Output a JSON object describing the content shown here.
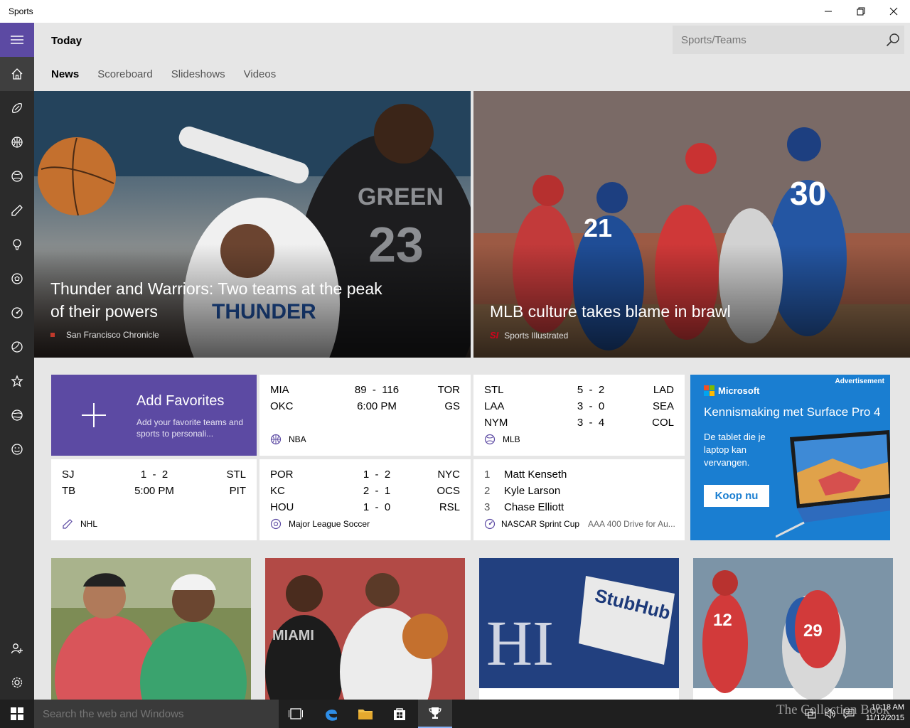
{
  "window": {
    "title": "Sports",
    "controls": [
      "minimize-icon",
      "restore-icon",
      "close-icon"
    ]
  },
  "nav": {
    "items": [
      "home-icon",
      "football-icon",
      "basketball-icon",
      "baseball-icon",
      "hockey-icon",
      "golf-icon",
      "soccer-icon",
      "racing-icon",
      "tennis-icon",
      "star-icon",
      "world-ball-icon",
      "smiley-icon"
    ],
    "bottom": [
      "user-add-icon",
      "gear-icon"
    ]
  },
  "header": {
    "title": "Today",
    "search_placeholder": "Sports/Teams",
    "tabs": [
      {
        "label": "News",
        "active": true
      },
      {
        "label": "Scoreboard",
        "active": false
      },
      {
        "label": "Slideshows",
        "active": false
      },
      {
        "label": "Videos",
        "active": false
      }
    ]
  },
  "hero": [
    {
      "title": "Thunder and Warriors: Two teams at the peak of their powers",
      "source": "San Francisco Chronicle",
      "source_logo": ""
    },
    {
      "title": "MLB culture takes blame in brawl",
      "source": "Sports Illustrated",
      "source_logo": "SI"
    }
  ],
  "favorites": {
    "title": "Add Favorites",
    "description": "Add your favorite teams and sports to personali..."
  },
  "scores": {
    "nba": {
      "league": "NBA",
      "games": [
        {
          "home": "MIA",
          "score": "89  -  116",
          "away": "TOR"
        },
        {
          "home": "OKC",
          "score": "6:00 PM",
          "away": "GS"
        }
      ]
    },
    "mlb": {
      "league": "MLB",
      "games": [
        {
          "home": "STL",
          "score": "5  -  2",
          "away": "LAD"
        },
        {
          "home": "LAA",
          "score": "3  -  0",
          "away": "SEA"
        },
        {
          "home": "NYM",
          "score": "3  -  4",
          "away": "COL"
        }
      ]
    },
    "nhl": {
      "league": "NHL",
      "games": [
        {
          "home": "SJ",
          "score": "1  -  2",
          "away": "STL"
        },
        {
          "home": "TB",
          "score": "5:00 PM",
          "away": "PIT"
        }
      ]
    },
    "mls": {
      "league": "Major League Soccer",
      "games": [
        {
          "home": "POR",
          "score": "1  -  2",
          "away": "NYC"
        },
        {
          "home": "KC",
          "score": "2  -  1",
          "away": "OCS"
        },
        {
          "home": "HOU",
          "score": "1  -  0",
          "away": "RSL"
        }
      ]
    },
    "nascar": {
      "league": "NASCAR Sprint Cup",
      "event": "AAA 400 Drive for Au...",
      "standings": [
        {
          "pos": "1",
          "driver": "Matt Kenseth"
        },
        {
          "pos": "2",
          "driver": "Kyle Larson"
        },
        {
          "pos": "3",
          "driver": "Chase Elliott"
        }
      ]
    }
  },
  "ad": {
    "tag": "Advertisement",
    "brand": "Microsoft",
    "title": "Kennismaking met Surface Pro 4",
    "body": "De tablet die je laptop kan vervangen.",
    "cta": "Koop nu"
  },
  "taskbar": {
    "search_placeholder": "Search the web and Windows",
    "time": "10:18 AM",
    "date": "11/12/2015",
    "watermark": "The Collection Book"
  },
  "colors": {
    "accent": "#5c4aa3",
    "rail": "#2b2b2b",
    "ad_blue": "#1a7ed1",
    "taskbar": "#1f1f1f"
  }
}
